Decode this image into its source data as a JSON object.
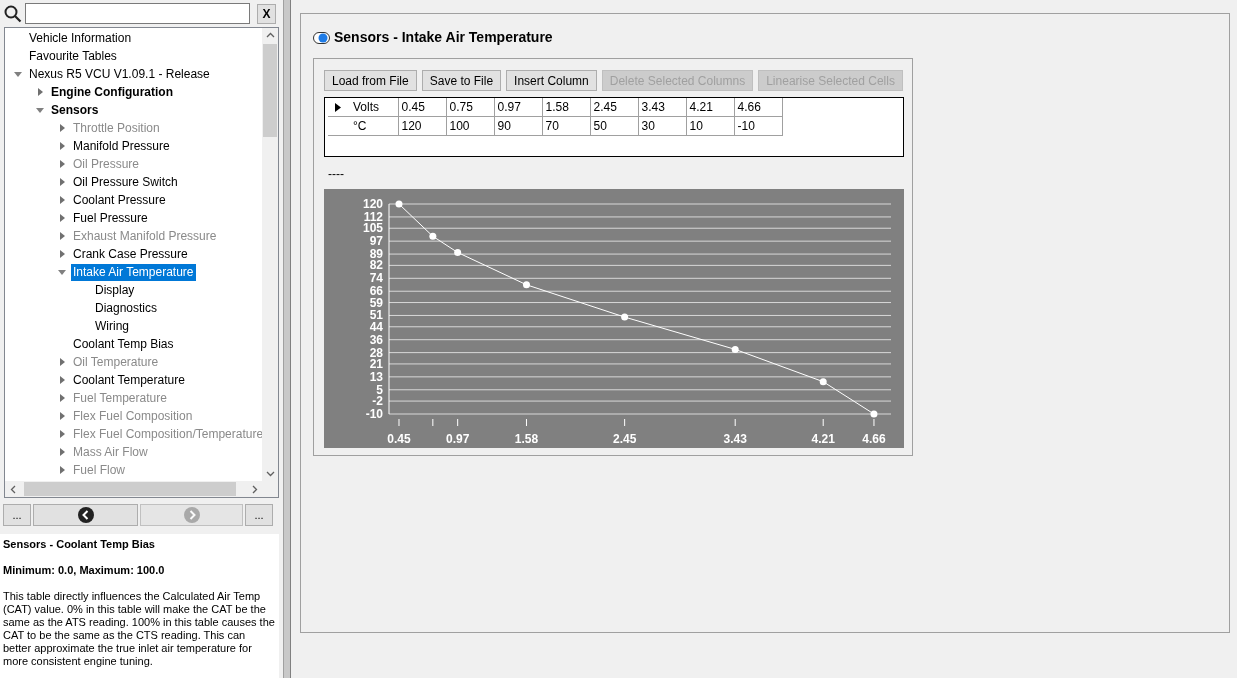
{
  "search": {
    "clear_label": "X"
  },
  "tree": [
    {
      "label": "Vehicle Information",
      "kind": "leaf",
      "disabled": false,
      "selected": false
    },
    {
      "label": "Favourite Tables",
      "kind": "leaf",
      "disabled": false,
      "selected": false
    },
    {
      "label": "Nexus R5 VCU V1.09.1 - Release",
      "kind": "leaf",
      "expanded": true,
      "disabled": false,
      "selected": false,
      "children": [
        {
          "label": "Engine Configuration",
          "kind": "category",
          "expanded": false,
          "disabled": false,
          "selected": false
        },
        {
          "label": "Sensors",
          "kind": "category",
          "expanded": true,
          "disabled": false,
          "selected": false,
          "children": [
            {
              "label": "Throttle Position",
              "kind": "leaf",
              "expanded": false,
              "disabled": true,
              "selected": false
            },
            {
              "label": "Manifold Pressure",
              "kind": "leaf",
              "expanded": false,
              "disabled": false,
              "selected": false
            },
            {
              "label": "Oil Pressure",
              "kind": "leaf",
              "expanded": false,
              "disabled": true,
              "selected": false
            },
            {
              "label": "Oil Pressure Switch",
              "kind": "leaf",
              "expanded": false,
              "disabled": false,
              "selected": false
            },
            {
              "label": "Coolant Pressure",
              "kind": "leaf",
              "expanded": false,
              "disabled": false,
              "selected": false
            },
            {
              "label": "Fuel Pressure",
              "kind": "leaf",
              "expanded": false,
              "disabled": false,
              "selected": false
            },
            {
              "label": "Exhaust Manifold Pressure",
              "kind": "leaf",
              "expanded": false,
              "disabled": true,
              "selected": false
            },
            {
              "label": "Crank Case Pressure",
              "kind": "leaf",
              "expanded": false,
              "disabled": false,
              "selected": false
            },
            {
              "label": "Intake Air Temperature",
              "kind": "leaf",
              "expanded": true,
              "disabled": false,
              "selected": true,
              "children": [
                {
                  "label": "Display",
                  "kind": "leaf",
                  "disabled": false,
                  "selected": false
                },
                {
                  "label": "Diagnostics",
                  "kind": "leaf",
                  "disabled": false,
                  "selected": false
                },
                {
                  "label": "Wiring",
                  "kind": "leaf",
                  "disabled": false,
                  "selected": false
                }
              ]
            },
            {
              "label": "Coolant Temp Bias",
              "kind": "leaf",
              "disabled": false,
              "selected": false
            },
            {
              "label": "Oil Temperature",
              "kind": "leaf",
              "expanded": false,
              "disabled": true,
              "selected": false
            },
            {
              "label": "Coolant Temperature",
              "kind": "leaf",
              "expanded": false,
              "disabled": false,
              "selected": false
            },
            {
              "label": "Fuel Temperature",
              "kind": "leaf",
              "expanded": false,
              "disabled": true,
              "selected": false
            },
            {
              "label": "Flex Fuel Composition",
              "kind": "leaf",
              "expanded": false,
              "disabled": true,
              "selected": false
            },
            {
              "label": "Flex Fuel Composition/Temperature",
              "kind": "leaf",
              "expanded": false,
              "disabled": true,
              "selected": false
            },
            {
              "label": "Mass Air Flow",
              "kind": "leaf",
              "expanded": false,
              "disabled": true,
              "selected": false
            },
            {
              "label": "Fuel Flow",
              "kind": "leaf",
              "expanded": false,
              "disabled": true,
              "selected": false
            }
          ]
        }
      ]
    }
  ],
  "nav": {
    "left_label": "...",
    "back_enabled": true,
    "forward_enabled": false,
    "right_label": "..."
  },
  "description": {
    "title": "Sensors - Coolant Temp Bias",
    "range": "Minimum: 0.0, Maximum: 100.0",
    "body": "This table directly influences the Calculated Air Temp (CAT) value. 0% in this table will make the CAT be the same as the ATS reading. 100% in this table causes the CAT to be the same as the CTS reading. This can better approximate the true inlet air temperature for more consistent engine tuning."
  },
  "panel": {
    "title": "Sensors - Intake Air Temperature",
    "buttons": [
      {
        "label": "Load from File",
        "disabled": false
      },
      {
        "label": "Save to File",
        "disabled": false
      },
      {
        "label": "Insert Column",
        "disabled": false
      },
      {
        "label": "Delete Selected Columns",
        "disabled": true
      },
      {
        "label": "Linearise Selected Cells",
        "disabled": true
      }
    ],
    "table": {
      "rows": [
        {
          "label": "Volts",
          "current": true,
          "cells": [
            "0.45",
            "0.75",
            "0.97",
            "1.58",
            "2.45",
            "3.43",
            "4.21",
            "4.66"
          ]
        },
        {
          "label": "°C",
          "current": false,
          "cells": [
            "120",
            "100",
            "90",
            "70",
            "50",
            "30",
            "10",
            "-10"
          ]
        }
      ]
    },
    "status": "----",
    "chart_data": {
      "type": "line",
      "x": [
        0.45,
        0.75,
        0.97,
        1.58,
        2.45,
        3.43,
        4.21,
        4.66
      ],
      "series": [
        {
          "color": "#ffffff",
          "marker": true,
          "values": [
            120,
            100,
            90,
            70,
            50,
            30,
            10,
            -10
          ]
        }
      ],
      "grid": true,
      "xlim": [
        0.3614,
        4.811
      ],
      "ylim": [
        -10,
        120
      ],
      "xticks": [
        0.45,
        0.97,
        1.58,
        2.45,
        3.43,
        4.21,
        4.66
      ],
      "yticks": [
        120,
        112,
        105,
        97,
        89,
        82,
        74,
        66,
        59,
        51,
        44,
        36,
        28,
        21,
        13,
        5,
        -2,
        -10
      ]
    }
  }
}
